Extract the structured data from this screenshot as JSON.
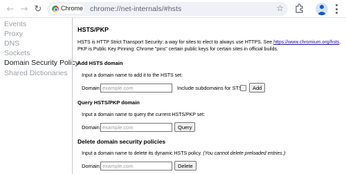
{
  "browser": {
    "chip_label": "Chrome",
    "url": "chrome://net-internals/#hsts"
  },
  "sidebar": {
    "items": [
      {
        "label": "Events"
      },
      {
        "label": "Proxy"
      },
      {
        "label": "DNS"
      },
      {
        "label": "Sockets"
      },
      {
        "label": "Domain Security Policy"
      },
      {
        "label": "Shared Dictionaries"
      }
    ],
    "active_index": 4
  },
  "main": {
    "title": "HSTS/PKP",
    "intro_line1": "HSTS is HTTP Strict Transport Security: a way for sites to elect to always use HTTPS. See ",
    "intro_link": "https://www.chromium.org/hsts",
    "intro_line1_end": ".",
    "intro_line2": "PKP is Public Key Pinning: Chrome \"pins\" certain public keys for certain sites in official builds.",
    "add": {
      "heading": "Add HSTS domain",
      "note": "Input a domain name to add it to the HSTS set:",
      "domain_label": "Domain:",
      "placeholder": "example.com",
      "sts_label": "Include subdomains for STS:",
      "button": "Add"
    },
    "query": {
      "heading": "Query HSTS/PKP domain",
      "note": "Input a domain name to query the current HSTS/PKP set:",
      "domain_label": "Domain:",
      "placeholder": "example.com",
      "button": "Query"
    },
    "delete": {
      "heading": "Delete domain security policies",
      "note": "Input a domain name to delete its dynamic HSTS policy. ",
      "note_italic": "(You cannot delete preloaded entries.)",
      "note_end": ":",
      "domain_label": "Domain:",
      "placeholder": "example.com",
      "button": "Delete"
    }
  }
}
